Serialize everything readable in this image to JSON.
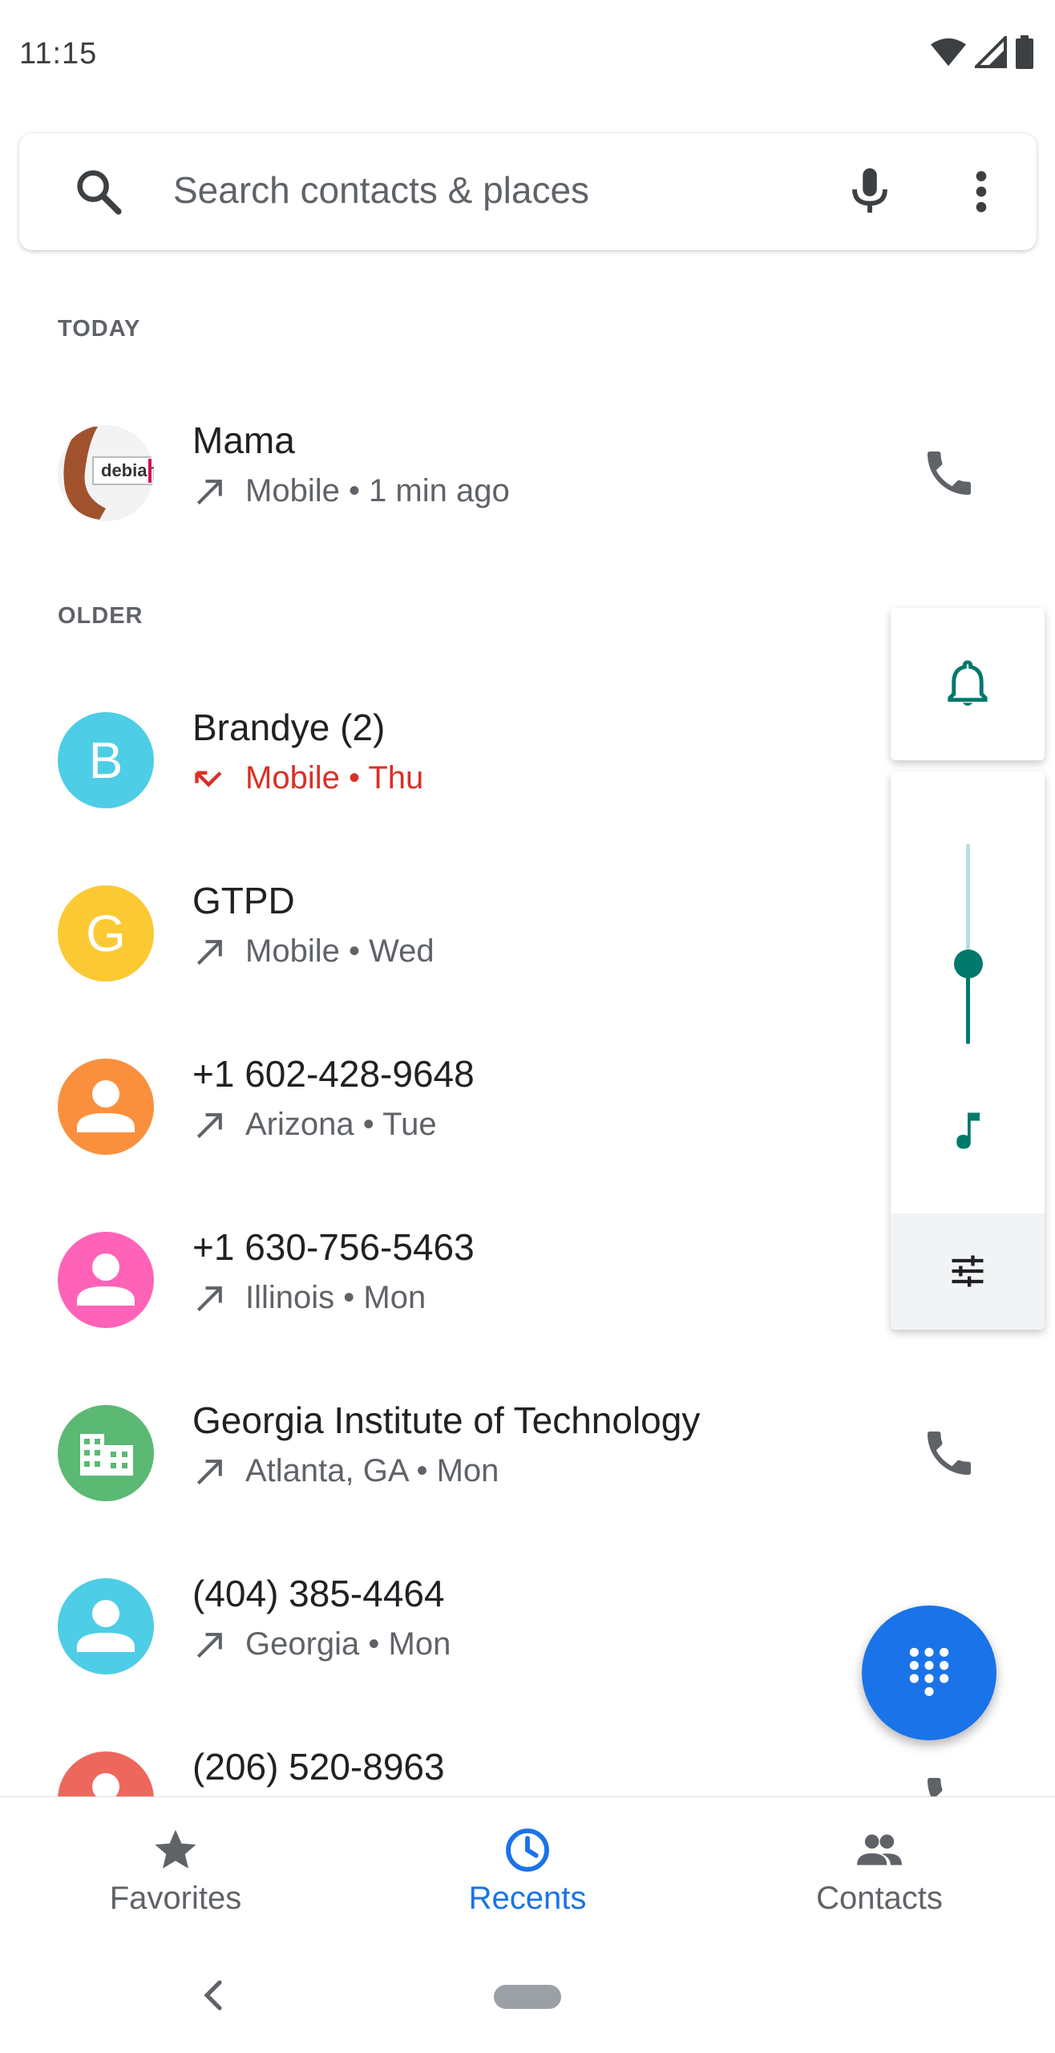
{
  "status_bar": {
    "time": "11:15",
    "icons": [
      "wifi-icon",
      "cell-signal-icon",
      "battery-icon"
    ]
  },
  "search": {
    "placeholder": "Search contacts & places",
    "icons": [
      "search-icon",
      "mic-icon",
      "more-vert-icon"
    ]
  },
  "sections": {
    "today": "TODAY",
    "older": "OLDER"
  },
  "calls": [
    {
      "name": "Mama",
      "detail": "Mobile • 1 min ago",
      "call_type": "outgoing",
      "avatar_letter": "",
      "avatar_type": "photo",
      "avatar_color": "#ffffff",
      "avatar_photo_text": "debian"
    },
    {
      "name": "Brandye (2)",
      "detail": "Mobile • Thu",
      "call_type": "missed",
      "avatar_letter": "B",
      "avatar_type": "letter",
      "avatar_color": "#4ecde6"
    },
    {
      "name": "GTPD",
      "detail": "Mobile • Wed",
      "call_type": "outgoing",
      "avatar_letter": "G",
      "avatar_type": "letter",
      "avatar_color": "#fbc933"
    },
    {
      "name": "+1 602-428-9648",
      "detail": "Arizona • Tue",
      "call_type": "outgoing",
      "avatar_letter": "",
      "avatar_type": "person",
      "avatar_color": "#fa903e"
    },
    {
      "name": "+1 630-756-5463",
      "detail": "Illinois • Mon",
      "call_type": "outgoing",
      "avatar_letter": "",
      "avatar_type": "person",
      "avatar_color": "#ff63b8"
    },
    {
      "name": "Georgia Institute of Technology",
      "detail": "Atlanta, GA • Mon",
      "call_type": "outgoing",
      "avatar_letter": "",
      "avatar_type": "business",
      "avatar_color": "#5bb974"
    },
    {
      "name": "(404) 385-4464",
      "detail": "Georgia • Mon",
      "call_type": "outgoing",
      "avatar_letter": "",
      "avatar_type": "person",
      "avatar_color": "#4ecde6"
    },
    {
      "name": "(206) 520-8963",
      "detail": "",
      "call_type": "outgoing",
      "avatar_letter": "",
      "avatar_type": "person",
      "avatar_color": "#ee675c"
    }
  ],
  "volume_panel": {
    "level_fraction": 0.4,
    "accent_color": "#00796b",
    "icons": [
      "bell-icon",
      "music-note-icon",
      "tune-icon"
    ]
  },
  "fab": {
    "icon": "dialpad-icon",
    "color": "#1a73e8"
  },
  "bottom_nav": {
    "items": [
      {
        "label": "Favorites",
        "icon": "star-icon",
        "active": false
      },
      {
        "label": "Recents",
        "icon": "clock-icon",
        "active": true
      },
      {
        "label": "Contacts",
        "icon": "people-icon",
        "active": false
      }
    ]
  },
  "system_nav": {
    "icons": [
      "back-icon",
      "home-pill"
    ]
  }
}
